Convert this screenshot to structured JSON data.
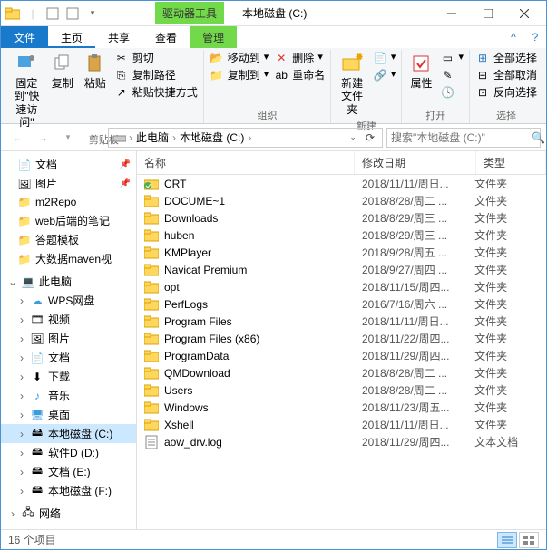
{
  "window": {
    "context_tab": "驱动器工具",
    "title": "本地磁盘 (C:)"
  },
  "tabs": {
    "file": "文件",
    "home": "主页",
    "share": "共享",
    "view": "查看",
    "manage": "管理"
  },
  "ribbon": {
    "pin": "固定到\"快\n速访问\"",
    "copy": "复制",
    "paste": "粘贴",
    "cut": "剪切",
    "copy_path": "复制路径",
    "paste_shortcut": "粘贴快捷方式",
    "clipboard_group": "剪贴板",
    "move_to": "移动到",
    "copy_to": "复制到",
    "delete": "删除",
    "rename": "重命名",
    "organize_group": "组织",
    "new_folder": "新建\n文件夹",
    "new_group": "新建",
    "properties": "属性",
    "open_group": "打开",
    "select_all": "全部选择",
    "select_none": "全部取消",
    "invert": "反向选择",
    "select_group": "选择"
  },
  "breadcrumb": {
    "this_pc": "此电脑",
    "drive": "本地磁盘 (C:)"
  },
  "search": {
    "placeholder": "搜索\"本地磁盘 (C:)\""
  },
  "nav": {
    "documents": "文档",
    "pictures": "图片",
    "m2repo": "m2Repo",
    "web_notes": "web后端的笔记",
    "templates": "答题模板",
    "bigdata": "大数据maven视",
    "this_pc": "此电脑",
    "wps": "WPS网盘",
    "videos": "视频",
    "pictures2": "图片",
    "documents2": "文档",
    "downloads": "下载",
    "music": "音乐",
    "desktop": "桌面",
    "drive_c": "本地磁盘 (C:)",
    "drive_d": "软件D (D:)",
    "drive_e": "文档 (E:)",
    "drive_f": "本地磁盘 (F:)",
    "network": "网络"
  },
  "columns": {
    "name": "名称",
    "modified": "修改日期",
    "type": "类型"
  },
  "files": [
    {
      "name": "CRT",
      "date": "2018/11/11/周日...",
      "type": "文件夹",
      "icon": "folder-check"
    },
    {
      "name": "DOCUME~1",
      "date": "2018/8/28/周二 ...",
      "type": "文件夹",
      "icon": "folder"
    },
    {
      "name": "Downloads",
      "date": "2018/8/29/周三 ...",
      "type": "文件夹",
      "icon": "folder"
    },
    {
      "name": "huben",
      "date": "2018/8/29/周三 ...",
      "type": "文件夹",
      "icon": "folder"
    },
    {
      "name": "KMPlayer",
      "date": "2018/9/28/周五 ...",
      "type": "文件夹",
      "icon": "folder"
    },
    {
      "name": "Navicat Premium",
      "date": "2018/9/27/周四 ...",
      "type": "文件夹",
      "icon": "folder"
    },
    {
      "name": "opt",
      "date": "2018/11/15/周四...",
      "type": "文件夹",
      "icon": "folder"
    },
    {
      "name": "PerfLogs",
      "date": "2016/7/16/周六 ...",
      "type": "文件夹",
      "icon": "folder"
    },
    {
      "name": "Program Files",
      "date": "2018/11/11/周日...",
      "type": "文件夹",
      "icon": "folder"
    },
    {
      "name": "Program Files (x86)",
      "date": "2018/11/22/周四...",
      "type": "文件夹",
      "icon": "folder"
    },
    {
      "name": "ProgramData",
      "date": "2018/11/29/周四...",
      "type": "文件夹",
      "icon": "folder"
    },
    {
      "name": "QMDownload",
      "date": "2018/8/28/周二 ...",
      "type": "文件夹",
      "icon": "folder"
    },
    {
      "name": "Users",
      "date": "2018/8/28/周二 ...",
      "type": "文件夹",
      "icon": "folder"
    },
    {
      "name": "Windows",
      "date": "2018/11/23/周五...",
      "type": "文件夹",
      "icon": "folder"
    },
    {
      "name": "Xshell",
      "date": "2018/11/11/周日...",
      "type": "文件夹",
      "icon": "folder"
    },
    {
      "name": "aow_drv.log",
      "date": "2018/11/29/周四...",
      "type": "文本文档",
      "icon": "file"
    }
  ],
  "status": {
    "count": "16 个项目"
  }
}
